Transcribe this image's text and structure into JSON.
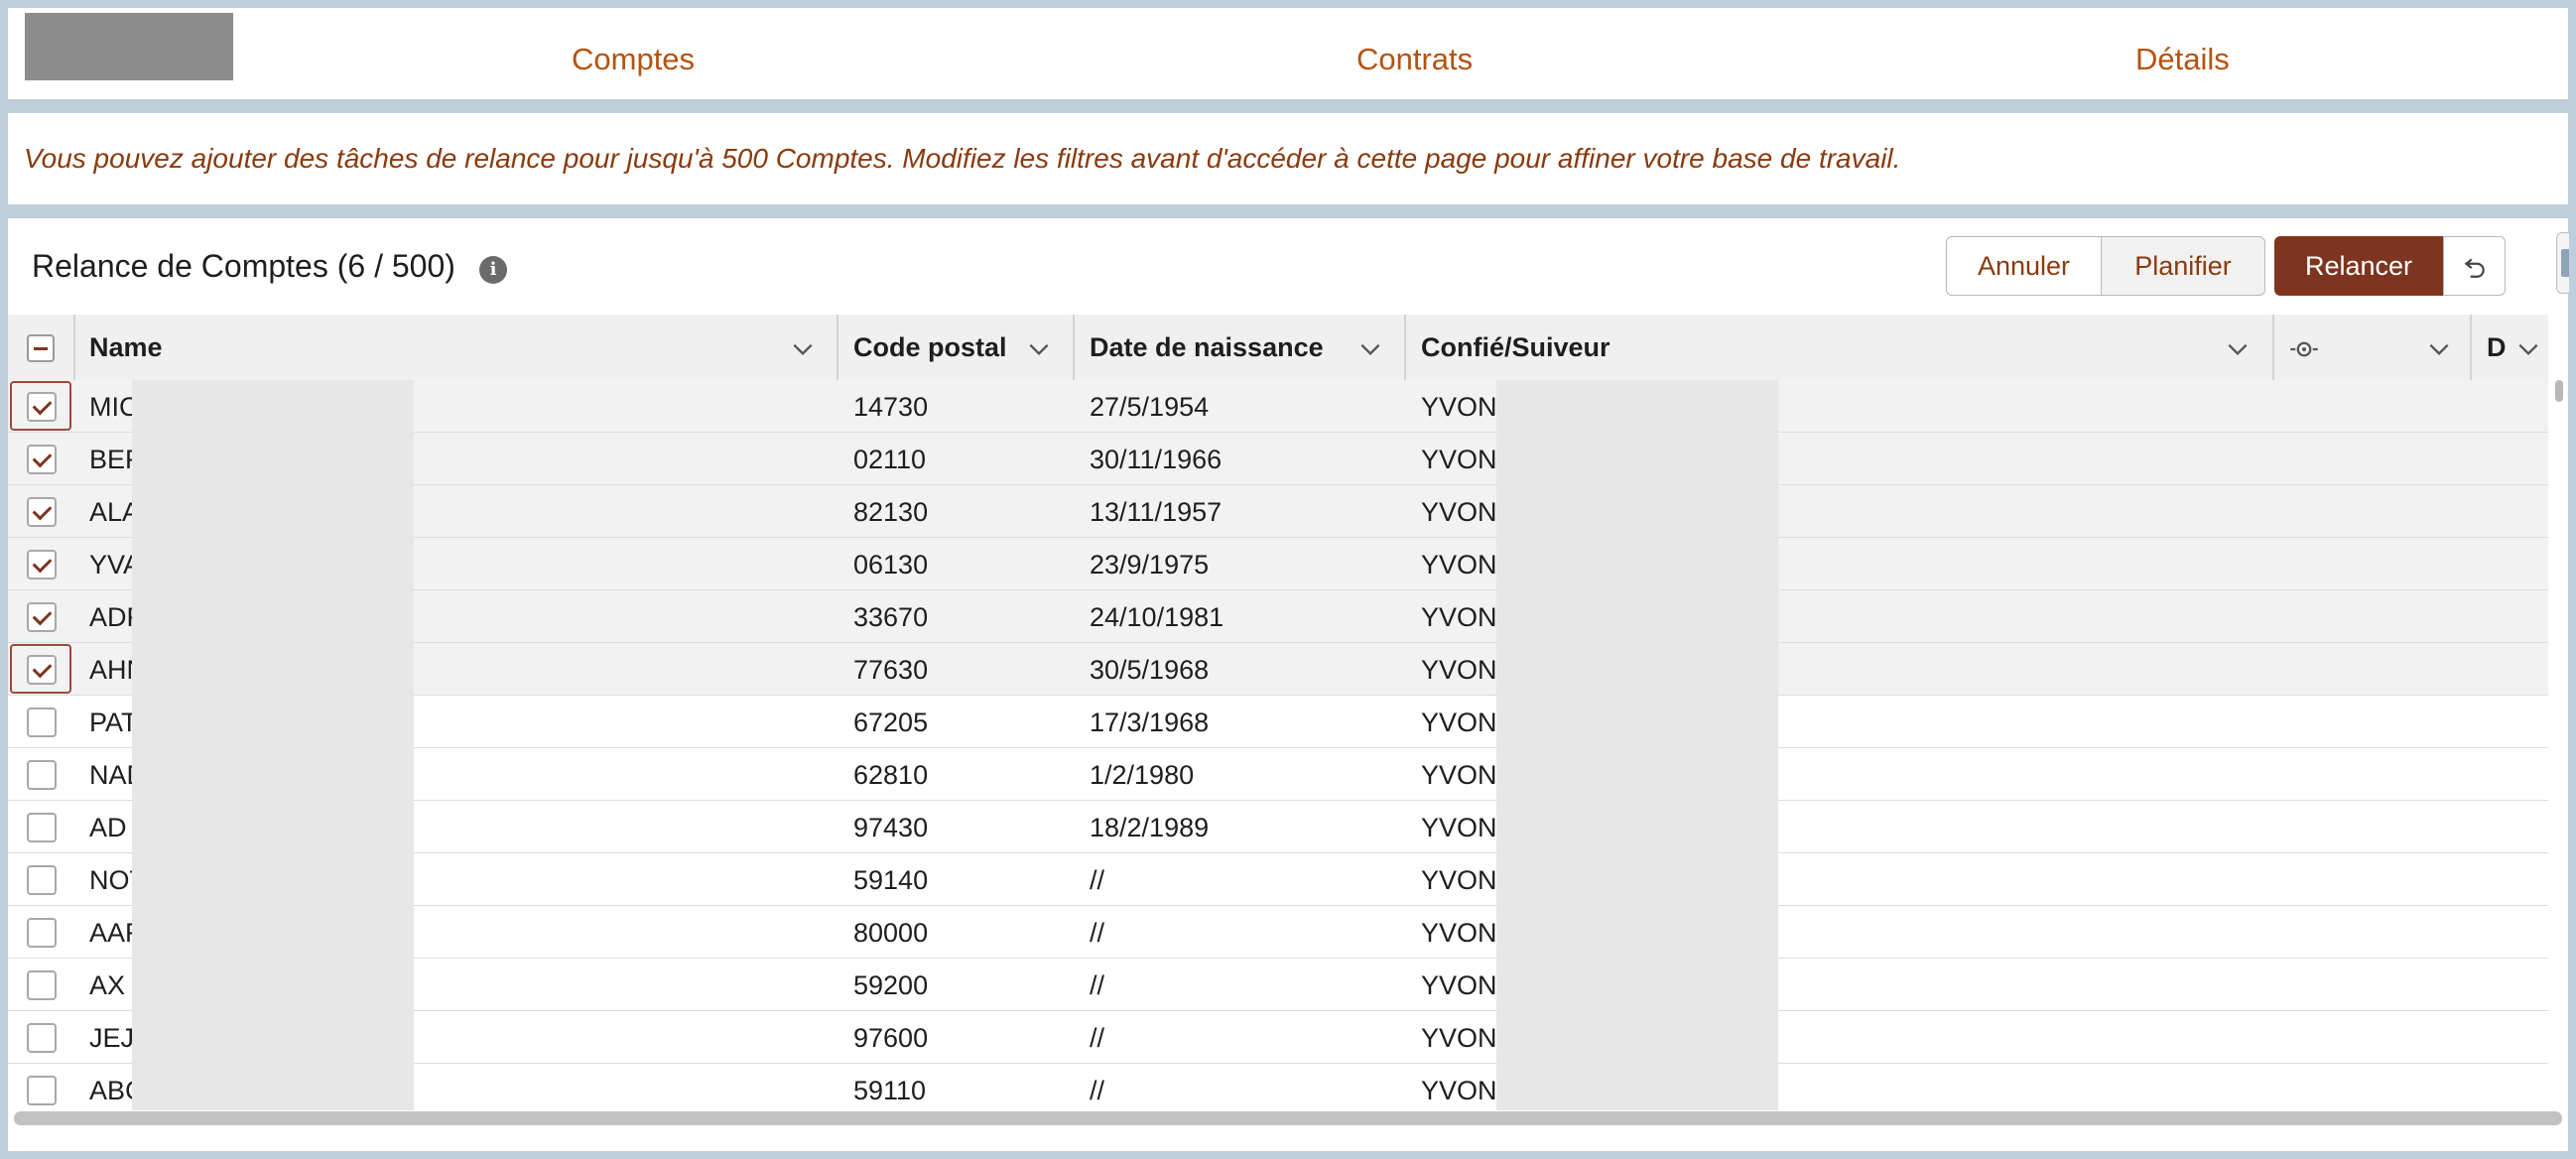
{
  "nav": {
    "items": [
      {
        "label": "Comptes"
      },
      {
        "label": "Contrats"
      },
      {
        "label": "Détails"
      }
    ]
  },
  "banner": {
    "text": "Vous pouvez ajouter des tâches de relance pour jusqu'à 500 Comptes. Modifiez les filtres avant d'accéder à cette page pour affiner votre base de travail."
  },
  "panel": {
    "title": "Relance de Comptes (6 / 500)",
    "info_icon": "info-icon",
    "buttons": {
      "annuler": "Annuler",
      "planifier": "Planifier",
      "relancer": "Relancer",
      "undo_icon": "undo-icon"
    }
  },
  "colors": {
    "accent": "#7d3520",
    "nav_link": "#b5520f",
    "banner_text": "#8a3a0d",
    "page_bg": "#bfcedd"
  },
  "table": {
    "columns": [
      {
        "label": "Name"
      },
      {
        "label": "Code postal"
      },
      {
        "label": "Date de naissance"
      },
      {
        "label": "Confié/Suiveur"
      },
      {
        "label": ""
      },
      {
        "label": "D"
      }
    ],
    "rows": [
      {
        "checked": true,
        "name": "MIC",
        "postal": "14730",
        "birth": "27/5/1954",
        "owner": "YVON"
      },
      {
        "checked": true,
        "name": "BER",
        "postal": "02110",
        "birth": "30/11/1966",
        "owner": "YVON"
      },
      {
        "checked": true,
        "name": "ALA",
        "postal": "82130",
        "birth": "13/11/1957",
        "owner": "YVON"
      },
      {
        "checked": true,
        "name": "YVA",
        "postal": "06130",
        "birth": "23/9/1975",
        "owner": "YVON"
      },
      {
        "checked": true,
        "name": "ADF",
        "postal": "33670",
        "birth": "24/10/1981",
        "owner": "YVON"
      },
      {
        "checked": true,
        "name": "AHN",
        "postal": "77630",
        "birth": "30/5/1968",
        "owner": "YVON"
      },
      {
        "checked": false,
        "name": "PAT",
        "postal": "67205",
        "birth": "17/3/1968",
        "owner": "YVON"
      },
      {
        "checked": false,
        "name": "NAD",
        "postal": "62810",
        "birth": "1/2/1980",
        "owner": "YVON"
      },
      {
        "checked": false,
        "name": "AD",
        "postal": "97430",
        "birth": "18/2/1989",
        "owner": "YVON"
      },
      {
        "checked": false,
        "name": "NOT",
        "postal": "59140",
        "birth": "//",
        "owner": "YVON"
      },
      {
        "checked": false,
        "name": "AAF",
        "postal": "80000",
        "birth": "//",
        "owner": "YVON"
      },
      {
        "checked": false,
        "name": "AX",
        "postal": "59200",
        "birth": "//",
        "owner": "YVON"
      },
      {
        "checked": false,
        "name": "JEJ",
        "postal": "97600",
        "birth": "//",
        "owner": "YVON"
      },
      {
        "checked": false,
        "name": "ABC",
        "postal": "59110",
        "birth": "//",
        "owner": "YVON"
      }
    ]
  }
}
